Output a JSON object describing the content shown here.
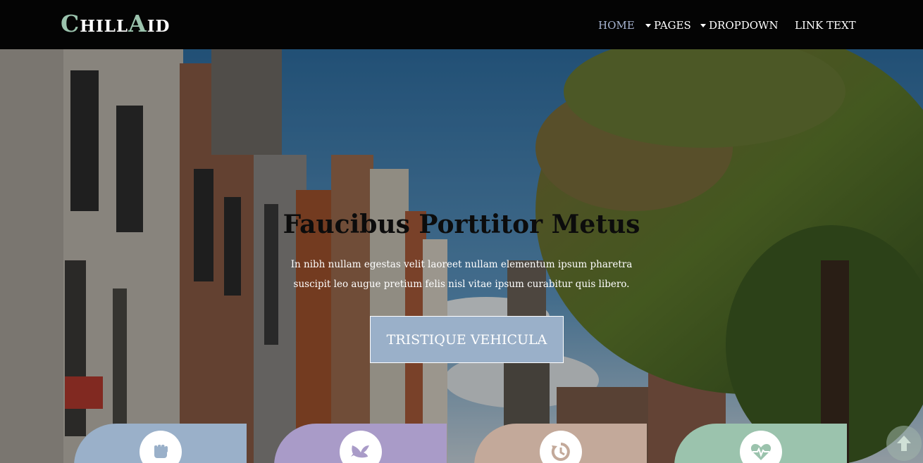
{
  "brand": {
    "logo_c": "C",
    "logo_hill": "HILL",
    "logo_a": "A",
    "logo_id": "ID"
  },
  "nav": {
    "home": "HOME",
    "pages": "PAGES",
    "dropdown": "DROPDOWN",
    "link": "LINK TEXT"
  },
  "hero": {
    "title": "Faucibus Porttitor Metus",
    "text": "In nibh nullam egestas velit laoreet nullam elementum ipsum pharetra suscipit leo augue pretium felis nisl vitae ipsum curabitur quis libero.",
    "button": "TRISTIQUE VEHICULA"
  },
  "cards": [
    {
      "icon": "fist-icon",
      "color": "#9ab0c9"
    },
    {
      "icon": "dove-icon",
      "color": "#a99bc8"
    },
    {
      "icon": "history-icon",
      "color": "#c3a99a"
    },
    {
      "icon": "heartbeat-icon",
      "color": "#9bc3ad"
    }
  ],
  "colors": {
    "navbar": "#040404",
    "accent_green": "#9bc3ad",
    "active_nav": "#a8b5d2",
    "button": "#9ab0c9"
  }
}
